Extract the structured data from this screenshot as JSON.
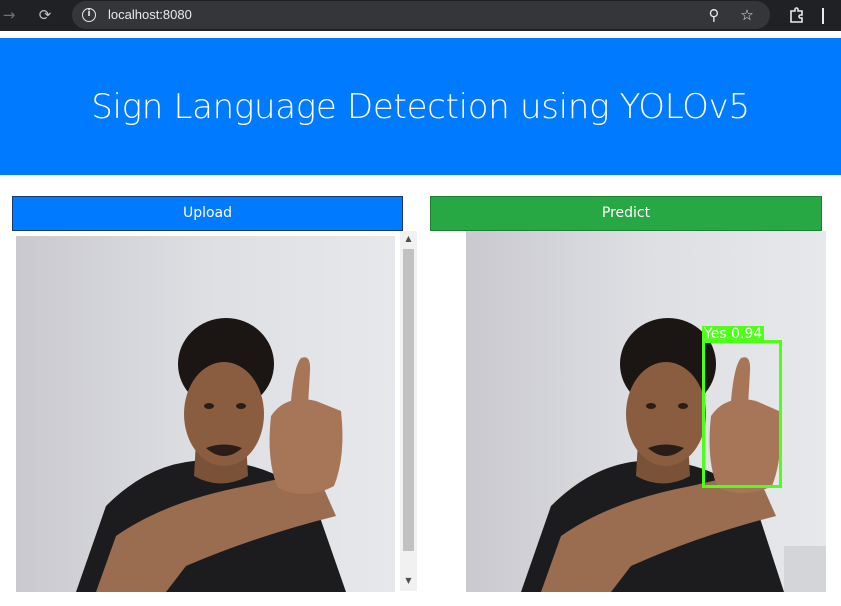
{
  "browser": {
    "url": "localhost:8080",
    "back_icon": "back-arrow-icon",
    "reload_icon": "reload-icon",
    "info_icon": "info-icon",
    "zoom_icon": "zoom-icon",
    "bookmark_icon": "star-icon",
    "extensions_icon": "puzzle-icon",
    "toolbar_color": "#202124"
  },
  "header": {
    "title": "Sign Language Detection using YOLOv5",
    "color": "#007bff"
  },
  "upload": {
    "label": "Upload",
    "color": "#007bff"
  },
  "predict": {
    "label": "Predict",
    "color": "#28a745"
  },
  "detection": {
    "label": "Yes  0.94",
    "box_color": "#4eff1a"
  },
  "photos": {
    "input": "person-thumbs-up-photo",
    "output": "person-thumbs-up-photo-annotated"
  }
}
